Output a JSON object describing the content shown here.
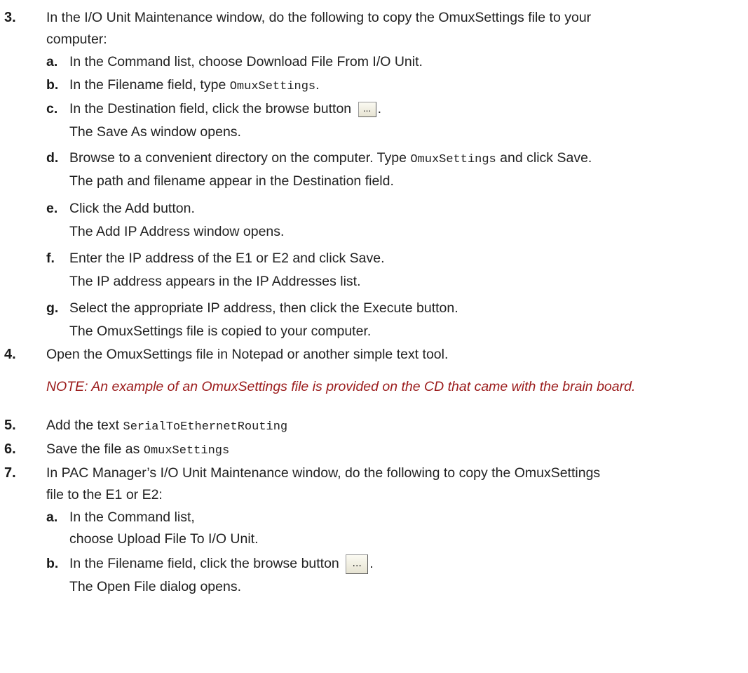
{
  "steps": [
    {
      "num": "3.",
      "line1": "In the I/O Unit Maintenance window, do the following to copy the OmuxSettings file to your",
      "line2": "computer:",
      "subs": [
        {
          "letter": "a.",
          "text": "In the Command list, choose Download File From I/O Unit."
        },
        {
          "letter": "b.",
          "pre": "In the Filename field, type ",
          "code": "OmuxSettings",
          "post": "."
        },
        {
          "letter": "c.",
          "pre": "In the Destination field, click the browse button ",
          "button": "...",
          "post": ".",
          "result": "The Save As window opens."
        },
        {
          "letter": "d.",
          "pre": "Browse to a convenient directory on the computer. Type ",
          "code": "OmuxSettings",
          "post": " and click Save.",
          "result": "The path and filename appear in the Destination field."
        },
        {
          "letter": "e.",
          "text": "Click the Add button.",
          "result": "The Add IP Address window opens."
        },
        {
          "letter": "f.",
          "text": "Enter the IP address of the E1 or E2 and click Save.",
          "result": "The IP address appears in the IP Addresses list."
        },
        {
          "letter": "g.",
          "text": "Select the appropriate IP address, then click the Execute button.",
          "result": "The OmuxSettings file is copied to your computer."
        }
      ]
    },
    {
      "num": "4.",
      "text": "Open the OmuxSettings file in Notepad or another simple text tool."
    },
    {
      "num": "5.",
      "pre": "Add the text ",
      "code": "SerialToEthernetRouting"
    },
    {
      "num": "6.",
      "pre": "Save the file as ",
      "code": "OmuxSettings"
    },
    {
      "num": "7.",
      "line1": "In PAC Manager’s I/O Unit Maintenance window, do the following to copy the OmuxSettings",
      "line2": "file to the E1 or E2:",
      "subs": [
        {
          "letter": "a.",
          "text": "In the Command list,",
          "text2": "choose Upload File To I/O Unit."
        },
        {
          "letter": "b.",
          "pre": "In the Filename field, click the browse button ",
          "button": "...",
          "post": ".",
          "result": "The Open File dialog opens."
        }
      ]
    }
  ],
  "note": "NOTE: An example of an OmuxSettings file is provided on the CD that came with the brain board.",
  "colors": {
    "note": "#9b1b1b",
    "text": "#222222"
  }
}
